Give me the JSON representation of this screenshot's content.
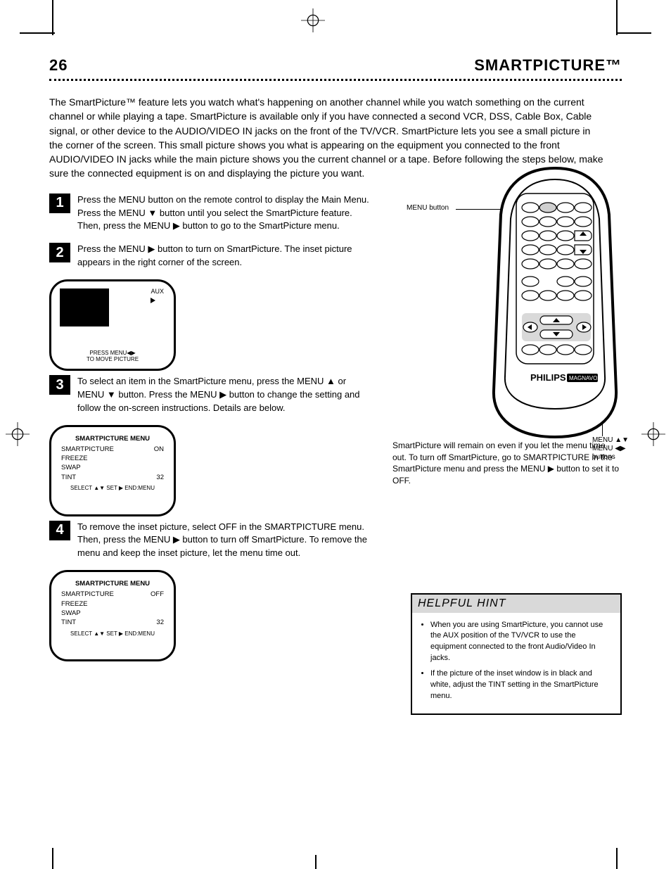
{
  "header": {
    "page_number": "26",
    "title": "SMARTPICTURE™"
  },
  "intro": "The SmartPicture™ feature lets you watch what's happening on another channel while you watch something on the current channel or while playing a tape. SmartPicture is available only if you have connected a second VCR, DSS, Cable Box, Cable signal, or other device to the AUDIO/VIDEO IN jacks on the front of the TV/VCR. SmartPicture lets you see a small picture in the corner of the screen. This small picture shows you what is appearing on the equipment you connected to the front AUDIO/VIDEO IN jacks while the main picture shows you the current channel or a tape. Before following the steps below, make sure the connected equipment is on and displaying the picture you want.",
  "steps": [
    {
      "n": "1",
      "text": "Press the MENU button on the remote control to display the Main Menu. Press the MENU ▼ button until you select the SmartPicture feature. Then, press the MENU ▶ button to go to the SmartPicture menu."
    },
    {
      "n": "2",
      "text": "Press the MENU ▶ button to turn on SmartPicture. The inset picture appears in the right corner of the screen."
    },
    {
      "n": "3",
      "text": "To select an item in the SmartPicture menu, press the MENU ▲ or MENU ▼ button. Press the MENU ▶ button to change the setting and follow the on-screen instructions. Details are below."
    },
    {
      "n": "4",
      "text": "To remove the inset picture, select OFF in the SMARTPICTURE menu. Then, press the MENU ▶ button to turn off SmartPicture. To remove the menu and keep the inset picture, let the menu time out."
    }
  ],
  "note": "SmartPicture will remain on even if you let the menu time out. To turn off SmartPicture, go to SMARTPICTURE in the SmartPicture menu and press the MENU ▶ button to set it to OFF.",
  "tv1": {
    "aux_label": "AUX",
    "play_icon": "▶",
    "hint1": "PRESS MENU◀▶",
    "hint2": "TO MOVE PICTURE"
  },
  "tv2": {
    "header": "SMARTPICTURE MENU",
    "rows": [
      [
        "SMARTPICTURE",
        "ON"
      ],
      [
        "FREEZE",
        ""
      ],
      [
        "SWAP",
        ""
      ],
      [
        "TINT",
        "32"
      ]
    ],
    "hint": "SELECT ▲▼  SET ▶  END:MENU"
  },
  "tv3": {
    "header": "SMARTPICTURE MENU",
    "rows": [
      [
        "SMARTPICTURE",
        "OFF"
      ],
      [
        "FREEZE",
        ""
      ],
      [
        "SWAP",
        ""
      ],
      [
        "TINT",
        "32"
      ]
    ],
    "hint": "SELECT ▲▼  SET ▶  END:MENU"
  },
  "remote": {
    "brand": "PHILIPS",
    "brand2": "MAGNAVOX",
    "label_menu": "MENU button",
    "label_arrows1": "MENU ▲▼",
    "label_arrows2": "MENU ◀▶",
    "label_arrows3": "buttons"
  },
  "tip": {
    "head": "HELPFUL HINT",
    "items": [
      "When you are using SmartPicture, you cannot use the AUX position of the TV/VCR to use the equipment connected to the front Audio/Video In jacks.",
      "If the picture of the inset window is in black and white, adjust the TINT setting in the SmartPicture menu."
    ]
  }
}
